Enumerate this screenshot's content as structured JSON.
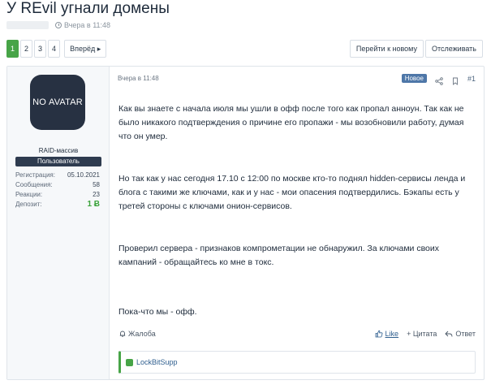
{
  "thread": {
    "title": "У REvil угнали домены",
    "posted_time": "Вчера в 11:48"
  },
  "pager": {
    "pages": [
      "1",
      "2",
      "3",
      "4"
    ],
    "active_page": "1",
    "next_label": "Вперёд ▸"
  },
  "top_actions": {
    "goto_new": "Перейти к новому",
    "watch": "Отслеживать"
  },
  "user": {
    "avatar_text_1": "NO",
    "avatar_text_2": "AVATAR",
    "name": "RAID-массив",
    "role": "Пользователь",
    "stats": [
      {
        "label": "Регистрация:",
        "value": "05.10.2021"
      },
      {
        "label": "Сообщения:",
        "value": "58"
      },
      {
        "label": "Реакции:",
        "value": "23"
      },
      {
        "label": "Депозит:",
        "value": "1 Ƀ"
      }
    ]
  },
  "post": {
    "time": "Вчера в 11:48",
    "new_badge": "Новое",
    "number": "#1",
    "paragraphs": [
      "Как вы знаете с начала июля мы ушли в офф после того как пропал анноун. Так как не было никакого подтверждения о причине его пропажи - мы возобновили работу, думая что он умер.",
      "Но так как у нас сегодня 17.10 с 12:00 по москве кто-то поднял hidden-сервисы ленда и блога с такими же ключами, как и у нас - мои опасения подтвердились. Бэкапы есть у третей стороны с ключами онион-сервисов.",
      "Проверил сервера - признаков компрометации не обнаружил. За ключами своих кампаний - обращайтесь ко мне в токс.",
      "Пока-что мы - офф."
    ],
    "report": "Жалоба",
    "like": "Like",
    "quote": "+ Цитата",
    "reply": "Ответ",
    "liked_by": "LockBitSupp"
  },
  "colors": {
    "accent_green": "#47a447",
    "badge_blue": "#4e77a8",
    "avatar_bg": "#273142"
  }
}
